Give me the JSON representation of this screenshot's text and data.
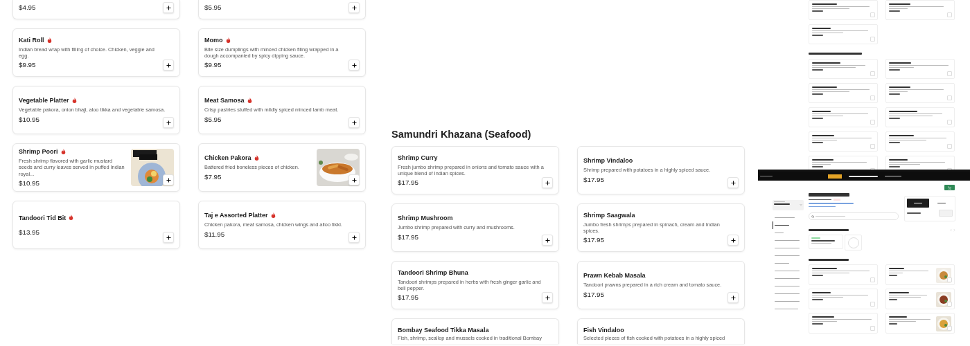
{
  "menu_section": {
    "items": [
      {
        "kind": "cut",
        "price": "$4.95"
      },
      {
        "kind": "cut",
        "price": "$5.95"
      },
      {
        "kind": "full",
        "name": "Kati Roll",
        "spicy": true,
        "description": "Indian bread wrap with filling of choice. Chicken, veggie and egg.",
        "price": "$9.95",
        "photo": false
      },
      {
        "kind": "full",
        "name": "Momo",
        "spicy": true,
        "description": "Bite size dumplings with minced chicken filing wrapped in a dough accompanied by spicy dipping sauce.",
        "price": "$9.95",
        "photo": false
      },
      {
        "kind": "full",
        "name": "Vegetable Platter",
        "spicy": true,
        "description": "Vegetable pakora, onion bhaji, aloo tikka and vegetable samosa.",
        "price": "$10.95",
        "photo": false
      },
      {
        "kind": "full",
        "name": "Meat Samosa",
        "spicy": true,
        "description": "Crisp pastries stuffed with mildly spiced minced lamb meat.",
        "price": "$5.95",
        "photo": false
      },
      {
        "kind": "full",
        "name": "Shrimp Poori",
        "spicy": true,
        "description": "Fresh shrimp flavored with garlic mustard seeds and curry leaves served in puffed Indian royal...",
        "price": "$10.95",
        "photo": true
      },
      {
        "kind": "full",
        "name": "Chicken Pakora",
        "spicy": true,
        "description": "Battered fried boneless pieces of chicken.",
        "price": "$7.95",
        "photo": true
      },
      {
        "kind": "full",
        "name": "Tandoori Tid Bit",
        "spicy": true,
        "price": "$13.95",
        "photo": false
      },
      {
        "kind": "full",
        "name": "Taj e Assorted Platter",
        "spicy": true,
        "description": "Chicken pakora, meat samosa, chicken wings and alloo tikki.",
        "price": "$11.95",
        "photo": false
      }
    ]
  },
  "seafood_section": {
    "title": "Samundri Khazana (Seafood)",
    "items": [
      {
        "kind": "full",
        "name": "Shrimp Curry",
        "spicy": false,
        "description": "Fresh jumbo shrimp prepared in onions and tomato sauce with a unique blend of Indian spices.",
        "price": "$17.95",
        "photo": false
      },
      {
        "kind": "full",
        "name": "Shrimp Vindaloo",
        "spicy": false,
        "description": "Shrimp prepared with potatoes in a highly spiced sauce.",
        "price": "$17.95",
        "photo": false
      },
      {
        "kind": "full",
        "name": "Shrimp Mushroom",
        "spicy": false,
        "description": "Jumbo shrimp prepared with curry and mushrooms.",
        "price": "$17.95",
        "photo": false
      },
      {
        "kind": "full",
        "name": "Shrimp Saagwala",
        "spicy": false,
        "description": "Jumbo fresh shrimps prepared in spinach, cream and Indian spices.",
        "price": "$17.95",
        "photo": false
      },
      {
        "kind": "full",
        "name": "Tandoori Shrimp Bhuna",
        "spicy": false,
        "description": "Tandoori shrimps prepared in herbs with fresh ginger garlic and bell pepper.",
        "price": "$17.95",
        "photo": false
      },
      {
        "kind": "full",
        "name": "Prawn Kebab Masala",
        "spicy": false,
        "description": "Tandoori prawns prepared in a rich cream and tomato sauce.",
        "price": "$17.95",
        "photo": false
      },
      {
        "kind": "top",
        "name": "Bombay Seafood Tikka Masala",
        "spicy": false,
        "description": "Fish, shrimp, scallop and mussels cooked in traditional Bombay"
      },
      {
        "kind": "top",
        "name": "Fish Vindaloo",
        "spicy": false,
        "description": "Selected pieces of fish cooked with potatoes in a highly spiced"
      }
    ]
  }
}
